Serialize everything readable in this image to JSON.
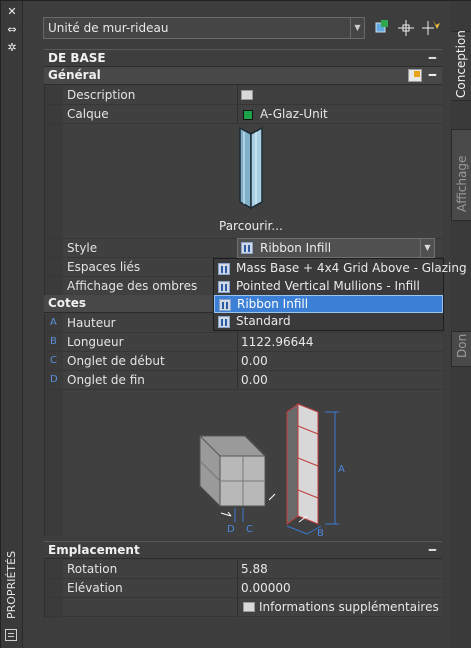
{
  "palette": {
    "title": "PROPRIÉTÉS"
  },
  "left_toolbar": {
    "close_glyph": "✕",
    "autohide_glyph": "⇔",
    "settings_glyph": "✲"
  },
  "selector": {
    "value": "Unité de mur-rideau"
  },
  "tabs": [
    {
      "label": "Conception"
    },
    {
      "label": "Affichage"
    },
    {
      "label": "Don"
    }
  ],
  "sections": {
    "base": {
      "title": "DE BASE",
      "general": {
        "title": "Général",
        "rows": {
          "description": {
            "label": "Description",
            "value": ""
          },
          "layer": {
            "label": "Calque",
            "value": "A-Glaz-Unit",
            "swatch": "#1aa34a"
          },
          "browse": {
            "label": "Parcourir..."
          },
          "style": {
            "label": "Style",
            "value": "Ribbon Infill"
          },
          "spaces": {
            "label": "Espaces liés"
          },
          "shadow": {
            "label": "Affichage des ombres"
          }
        }
      }
    },
    "dims": {
      "title": "Cotes",
      "rows": [
        {
          "letter": "A",
          "label": "Hauteur",
          "value": ""
        },
        {
          "letter": "B",
          "label": "Longueur",
          "value": "1122.96644"
        },
        {
          "letter": "C",
          "label": "Onglet de début",
          "value": "0.00"
        },
        {
          "letter": "D",
          "label": "Onglet de fin",
          "value": "0.00"
        }
      ],
      "diagram": {
        "a": "A",
        "b": "B",
        "c": "C",
        "d": "D"
      }
    },
    "location": {
      "title": "Emplacement",
      "rows": [
        {
          "label": "Rotation",
          "value": "5.88"
        },
        {
          "label": "Elévation",
          "value": "0.00000"
        }
      ],
      "extra": "Informations supplémentaires"
    }
  },
  "style_dropdown": {
    "options": [
      {
        "label": "Mass Base + 4x4 Grid Above - Glazing",
        "selected": false
      },
      {
        "label": "Pointed Vertical Mullions - Infill",
        "selected": false
      },
      {
        "label": "Ribbon Infill",
        "selected": true
      },
      {
        "label": "Standard",
        "selected": false
      }
    ]
  }
}
